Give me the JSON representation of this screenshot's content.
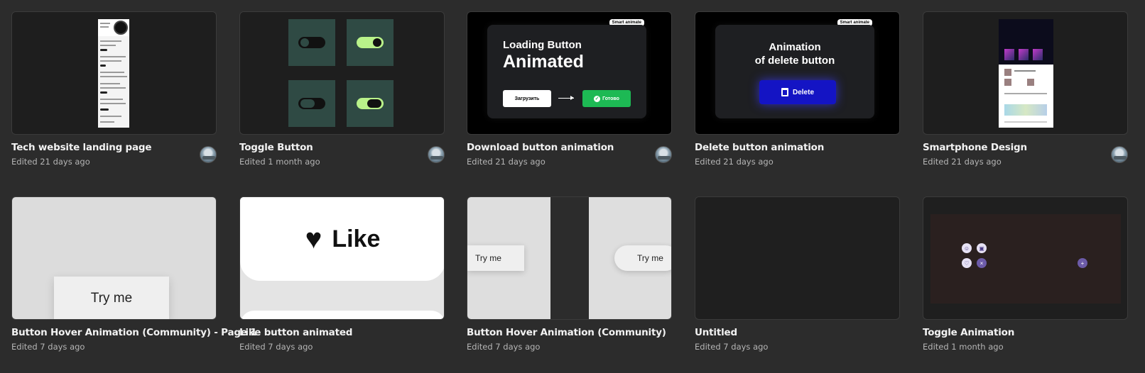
{
  "files": [
    {
      "title": "Tech website landing page",
      "edited": "Edited 21 days ago",
      "has_avatar": true
    },
    {
      "title": "Toggle Button",
      "edited": "Edited 1 month ago",
      "has_avatar": true
    },
    {
      "title": "Download button animation",
      "edited": "Edited 21 days ago",
      "has_avatar": true,
      "thumb": {
        "tag": "Smart animate",
        "line1": "Loading Button",
        "line2": "Animated",
        "btn_left": "Загрузить",
        "btn_right": "Готово"
      }
    },
    {
      "title": "Delete button animation",
      "edited": "Edited 21 days ago",
      "has_avatar": false,
      "thumb": {
        "tag": "Smart animate",
        "line1": "Animation",
        "line2": "of delete button",
        "button": "Delete"
      }
    },
    {
      "title": "Smartphone Design",
      "edited": "Edited 21 days ago",
      "has_avatar": true
    },
    {
      "title": "Button Hover Animation (Community) - Page 1",
      "edited": "Edited 7 days ago",
      "has_avatar": false,
      "thumb": {
        "button": "Try me"
      }
    },
    {
      "title": "Like button animated",
      "edited": "Edited 7 days ago",
      "has_avatar": false,
      "thumb": {
        "label": "Like"
      }
    },
    {
      "title": "Button Hover Animation (Community)",
      "edited": "Edited 7 days ago",
      "has_avatar": false,
      "thumb": {
        "button_left": "Try me",
        "button_right": "Try me"
      }
    },
    {
      "title": "Untitled",
      "edited": "Edited 7 days ago",
      "has_avatar": false
    },
    {
      "title": "Toggle Animation",
      "edited": "Edited 1 month ago",
      "has_avatar": false
    }
  ],
  "colors": {
    "background": "#2c2c2c",
    "thumb_border": "#3b3b3b",
    "toggle_on": "#b9f28a",
    "go_green": "#1db954",
    "delete_blue": "#1414c4"
  }
}
